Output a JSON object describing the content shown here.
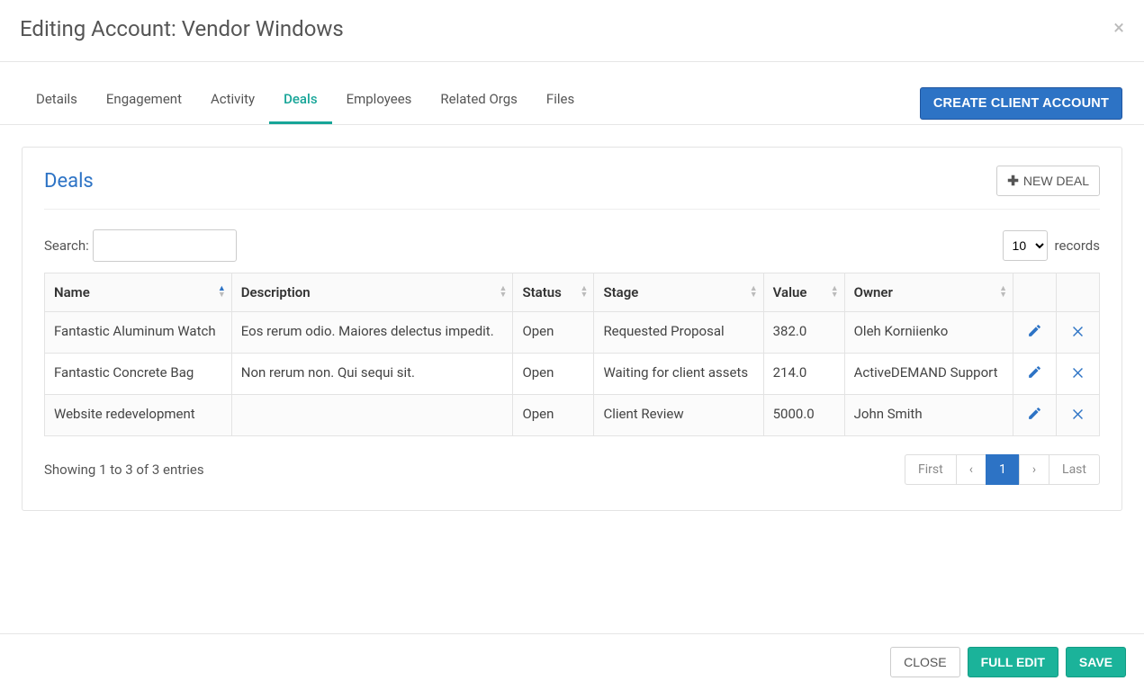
{
  "header": {
    "title": "Editing Account: Vendor Windows"
  },
  "tabs": {
    "items": [
      {
        "label": "Details"
      },
      {
        "label": "Engagement"
      },
      {
        "label": "Activity"
      },
      {
        "label": "Deals"
      },
      {
        "label": "Employees"
      },
      {
        "label": "Related Orgs"
      },
      {
        "label": "Files"
      }
    ],
    "active_index": 3,
    "create_button": "CREATE CLIENT ACCOUNT"
  },
  "panel": {
    "title": "Deals",
    "new_deal_label": "NEW DEAL",
    "search_label": "Search:",
    "search_value": "",
    "records_label": "records",
    "records_value": "10",
    "columns": {
      "name": "Name",
      "description": "Description",
      "status": "Status",
      "stage": "Stage",
      "value": "Value",
      "owner": "Owner"
    },
    "rows": [
      {
        "name": "Fantastic Aluminum Watch",
        "description": "Eos rerum odio. Maiores delectus impedit.",
        "status": "Open",
        "stage": "Requested Proposal",
        "value": "382.0",
        "owner": "Oleh Korniienko"
      },
      {
        "name": "Fantastic Concrete Bag",
        "description": "Non rerum non. Qui sequi sit.",
        "status": "Open",
        "stage": "Waiting for client assets",
        "value": "214.0",
        "owner": "ActiveDEMAND Support"
      },
      {
        "name": "Website redevelopment",
        "description": "",
        "status": "Open",
        "stage": "Client Review",
        "value": "5000.0",
        "owner": "John Smith"
      }
    ],
    "showing": "Showing 1 to 3 of 3 entries",
    "pagination": {
      "first": "First",
      "last": "Last",
      "current": "1"
    }
  },
  "footer": {
    "close": "CLOSE",
    "full_edit": "FULL EDIT",
    "save": "SAVE"
  }
}
